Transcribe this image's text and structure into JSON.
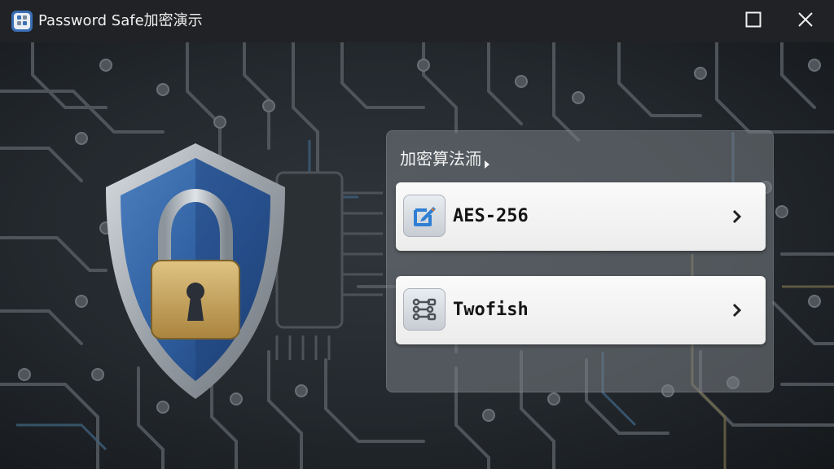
{
  "window": {
    "title": "Password Safe加密演示",
    "app_icon": "app-logo-icon",
    "controls": {
      "maximize_icon": "maximize-icon",
      "close_icon": "close-icon"
    }
  },
  "background": {
    "description_icon": "circuit-board-background"
  },
  "hero": {
    "icon": "shield-padlock-icon"
  },
  "panel": {
    "heading": "加密算法洏",
    "heading_icon": "chevron-right-icon",
    "options": [
      {
        "label": "AES-256",
        "icon": "edit-document-icon",
        "accent": "#2f7fd4"
      },
      {
        "label": "Twofish",
        "icon": "network-nodes-icon",
        "accent": "#4a5158"
      }
    ]
  },
  "colors": {
    "titlebar": "#202225",
    "shield_blue": "#2f5fa0",
    "lock_gold": "#c9a45e",
    "panel_button": "#f3f3f3"
  }
}
